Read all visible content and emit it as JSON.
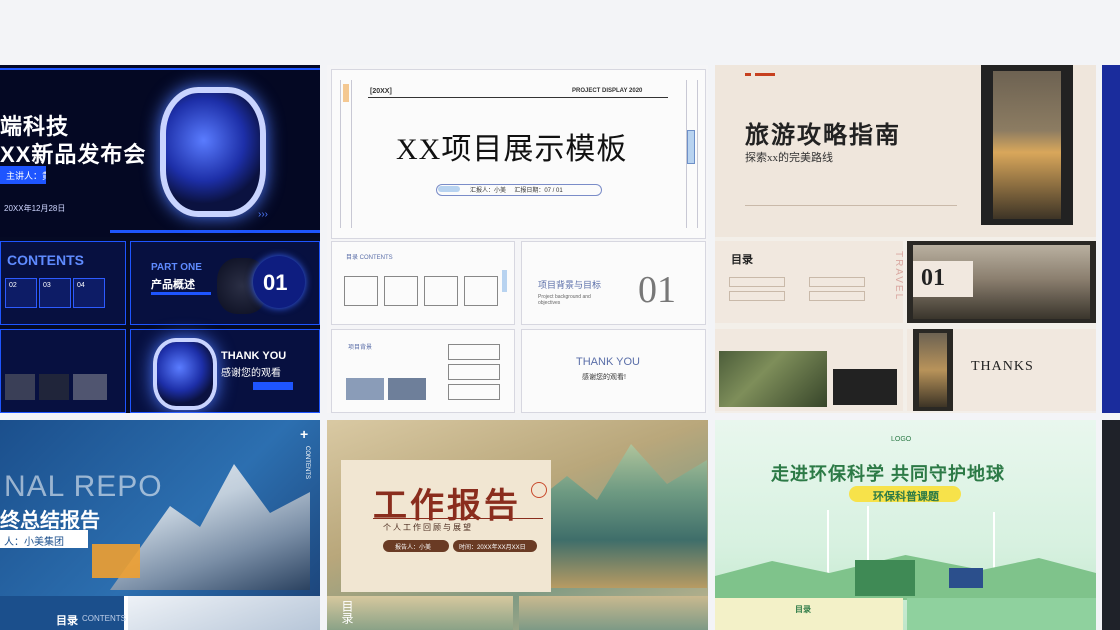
{
  "cards": {
    "tech": {
      "title1": "端科技",
      "title2": "XX新品发布会",
      "speaker": "主讲人：黄小黄",
      "date": "20XX年12月28日",
      "contents": "CONTENTS",
      "n1": "02",
      "n2": "03",
      "n3": "04",
      "partone": "PART ONE",
      "overview": "产品概述",
      "num": "01",
      "thanks_en": "THANK YOU",
      "thanks_cn": "感谢您的观看"
    },
    "project": {
      "tag": "[20XX]",
      "sub_en": "PROJECT DISPLAY 2020",
      "title": "XX项目展示模板",
      "info": "汇报人：小美     汇报日期：07 / 01",
      "contents_label": "目录 CONTENTS",
      "section_title": "项目背景与目标",
      "section_sub": "Project background and objectives",
      "section_num": "01",
      "background_label": "项目背景",
      "thanks_en": "THANK YOU",
      "thanks_cn": "感谢您的观看!"
    },
    "travel": {
      "title": "旅游攻略指南",
      "subtitle": "探索xx的完美路线",
      "menu_title": "目录",
      "section_num": "01",
      "vertical": "TRAVEL",
      "thanks": "THANKS"
    },
    "report": {
      "big_en": "NAL REPO",
      "title": "终总结报告",
      "presenter": "人：小美集团",
      "side": "CONTENTS",
      "menu": "目录",
      "menu_en": "CONTENTS"
    },
    "work": {
      "title": "工作报告",
      "subtitle": "个 人 工 作 回 顾 与 展 望",
      "presenter": "报告人：小美",
      "date": "时间：20XX年XX月XX日",
      "menu": "目录"
    },
    "eco": {
      "logo": "LOGO",
      "title": "走进环保科学 共同守护地球",
      "badge": "环保科普课题",
      "menu": "目录"
    }
  },
  "colors": {
    "page_bg": "#f3f4f7",
    "tech_blue": "#1e55ff",
    "travel_beige": "#efe6dc",
    "eco_green": "#2c7a46",
    "eco_badge": "#f7e24a",
    "work_red": "#8a2d1d"
  }
}
